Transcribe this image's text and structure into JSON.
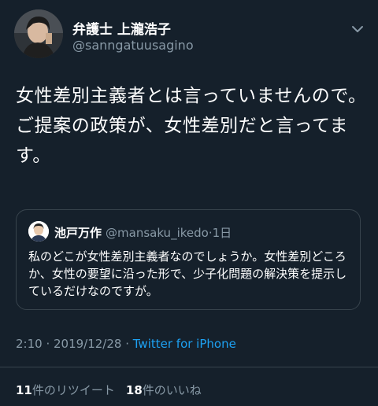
{
  "author": {
    "display_name": "弁護士 上瀧浩子",
    "handle": "@sanngatuusagino"
  },
  "tweet_text": "女性差別主義者とは言っていませんので。ご提案の政策が、女性差別だと言ってます。",
  "quoted_tweet": {
    "display_name": "池戸万作",
    "handle": "@mansaku_ikedo",
    "separator": "·",
    "time": "1日",
    "text": "私のどこが女性差別主義者なのでしょうか。女性差別どころか、女性の要望に沿った形で、少子化問題の解決策を提示しているだけなのですが。"
  },
  "meta": {
    "timestamp": "2:10 · 2019/12/28 · ",
    "source": "Twitter for iPhone"
  },
  "stats": {
    "retweets_count": "11",
    "retweets_label": "件のリツイート",
    "likes_count": "18",
    "likes_label": "件のいいね"
  },
  "icons": {
    "menu": "chevron-down-icon"
  },
  "colors": {
    "background": "#15202b",
    "secondary_text": "#8899a6",
    "link": "#1da1f2",
    "border": "#38444d"
  }
}
